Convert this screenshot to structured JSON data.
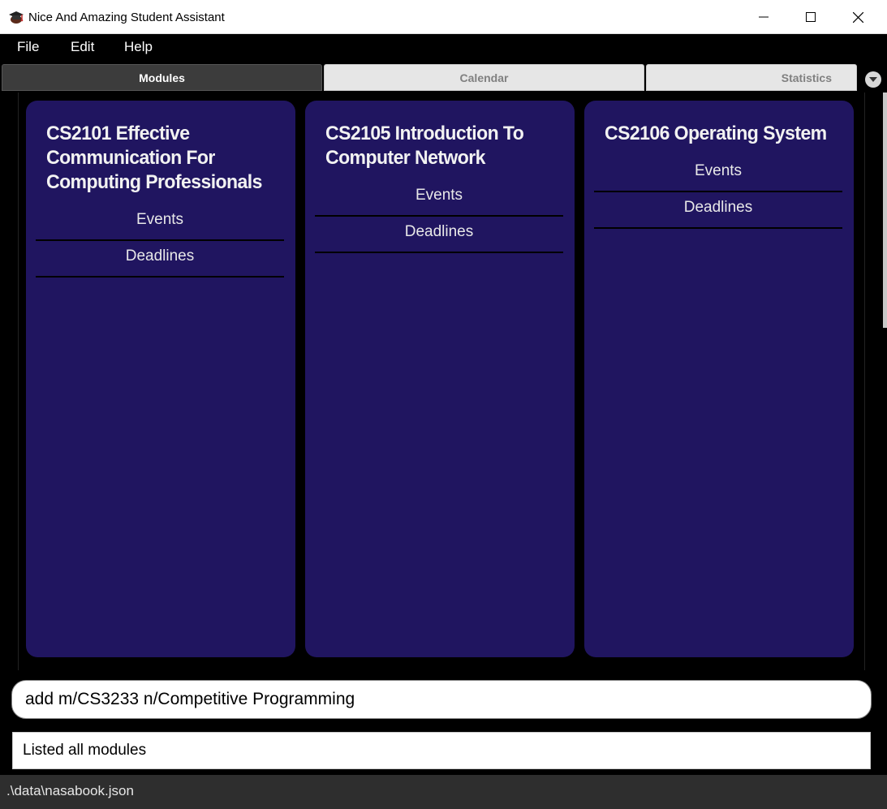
{
  "window": {
    "title": "Nice And Amazing Student Assistant"
  },
  "menu": {
    "items": [
      "File",
      "Edit",
      "Help"
    ]
  },
  "tabs": [
    {
      "label": "Modules",
      "active": true
    },
    {
      "label": "Calendar",
      "active": false
    },
    {
      "label": "Statistics",
      "active": false
    }
  ],
  "modules": [
    {
      "title": "CS2101 Effective Communication For Computing Professionals",
      "events_label": "Events",
      "deadlines_label": "Deadlines"
    },
    {
      "title": "CS2105 Introduction To Computer Network",
      "events_label": "Events",
      "deadlines_label": "Deadlines"
    },
    {
      "title": "CS2106 Operating System",
      "events_label": "Events",
      "deadlines_label": "Deadlines"
    }
  ],
  "command": {
    "value": "add m/CS3233 n/Competitive Programming"
  },
  "result": {
    "text": "Listed all modules"
  },
  "status": {
    "path": ".\\data\\nasabook.json"
  },
  "colors": {
    "card": "#201560",
    "background": "#000000",
    "active_tab": "#3c3c3c",
    "status_bar": "#2e2e2e"
  },
  "icons": {
    "app": "graduation-cap-icon",
    "minimize": "minimize-icon",
    "maximize": "maximize-icon",
    "close": "close-icon",
    "tab_menu": "chevron-down-icon"
  }
}
